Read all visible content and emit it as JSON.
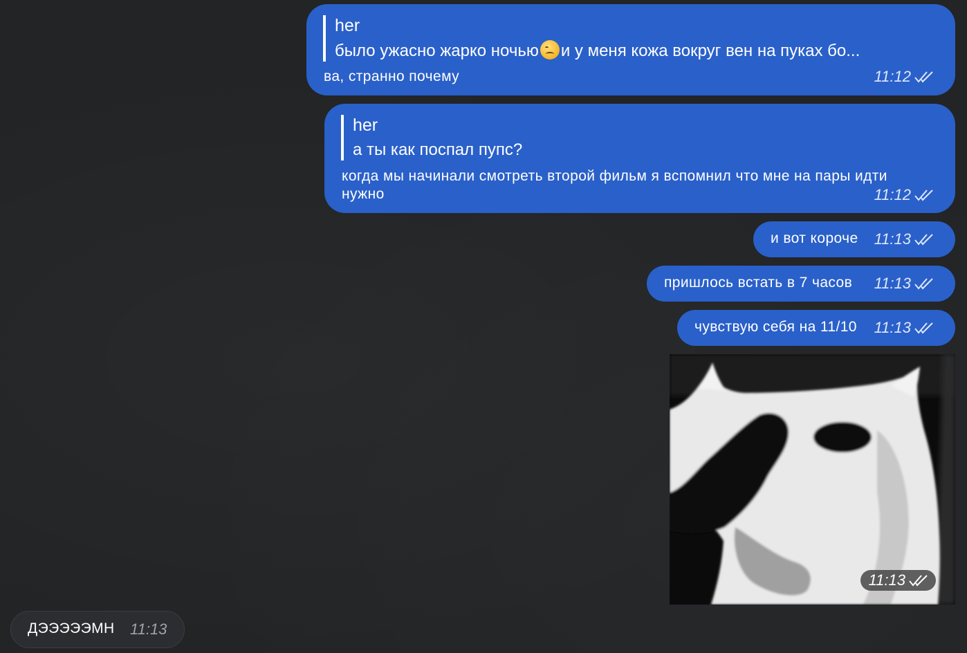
{
  "messages": [
    {
      "reply_author": "her",
      "reply_text_before": "было ужасно жарко ночью",
      "reply_text_after": "и у меня кожа вокруг вен на пуках бо...",
      "text": "ва, странно почему",
      "time": "11:12"
    },
    {
      "reply_author": "her",
      "reply_text": "а ты как поспал пупс?",
      "text_line1": "когда мы начинали смотреть второй фильм я вспомнил что мне на пары идти",
      "text_line2": "нужно",
      "time": "11:12"
    },
    {
      "text": "и вот короче",
      "time": "11:13"
    },
    {
      "text": "пришлось встать в 7 часов",
      "time": "11:13"
    },
    {
      "text": "чувствую себя на 11/10",
      "time": "11:13"
    },
    {
      "photo_subject": "black-and-white cat meme",
      "time": "11:13"
    },
    {
      "text": "ДЭЭЭЭЭМН",
      "time": "11:13"
    }
  ],
  "icons": {
    "read_status": "double-check-icon",
    "emoji": "woozy-face-emoji"
  },
  "colors": {
    "background": "#222426",
    "outgoing_bubble": "#2a60c9",
    "incoming_bubble": "#2b2d30"
  }
}
